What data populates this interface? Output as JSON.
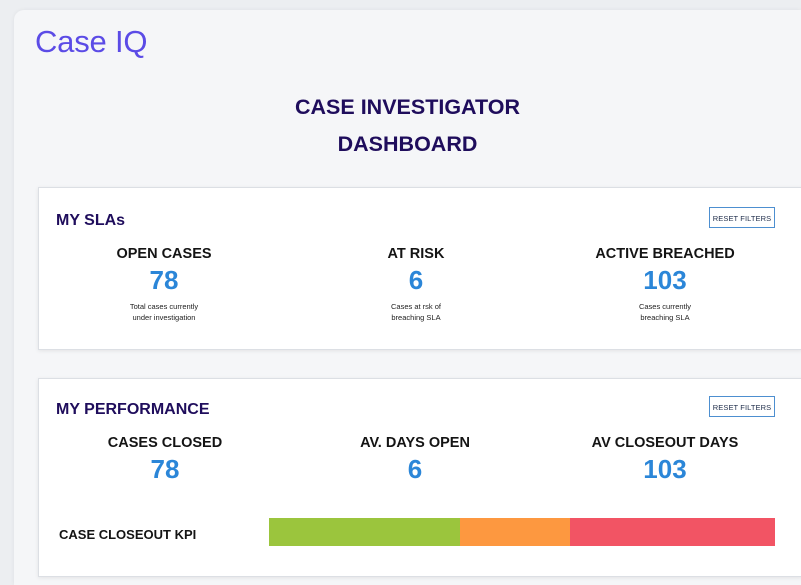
{
  "brand": {
    "logo": "Case IQ"
  },
  "page": {
    "title_line1": "CASE INVESTIGATOR",
    "title_line2": "DASHBOARD"
  },
  "sla": {
    "title": "MY SLAs",
    "reset_label": "RESET FILTERS",
    "stats": [
      {
        "label": "OPEN CASES",
        "value": "78",
        "desc1": "Total cases currently",
        "desc2": "under investigation"
      },
      {
        "label": "AT RISK",
        "value": "6",
        "desc1": "Cases at rsk of",
        "desc2": "breaching SLA"
      },
      {
        "label": "ACTIVE BREACHED",
        "value": "103",
        "desc1": "Cases currently",
        "desc2": "breaching SLA"
      }
    ]
  },
  "performance": {
    "title": "MY PERFORMANCE",
    "reset_label": "RESET FILTERS",
    "stats": [
      {
        "label": "CASES CLOSED",
        "value": "78"
      },
      {
        "label": "AV. DAYS OPEN",
        "value": "6"
      },
      {
        "label": "AV CLOSEOUT DAYS",
        "value": "103"
      }
    ],
    "kpi": {
      "label": "CASE CLOSEOUT KPI",
      "segments": [
        {
          "status": "good",
          "fraction": 0.378,
          "color": "#9bc53d"
        },
        {
          "status": "warning",
          "fraction": 0.216,
          "color": "#fd9840"
        },
        {
          "status": "critical",
          "fraction": 0.406,
          "color": "#f25464"
        }
      ]
    }
  }
}
